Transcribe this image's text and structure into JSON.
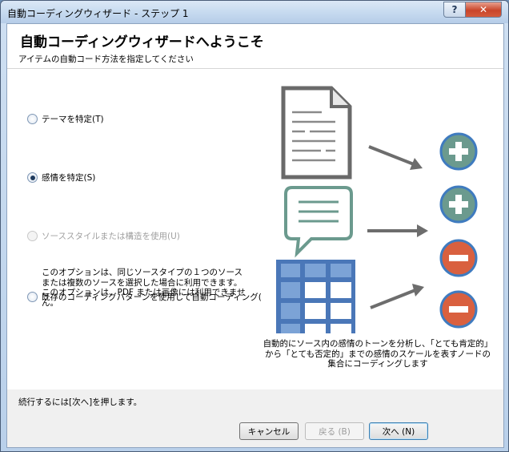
{
  "window": {
    "title": "自動コーディングウィザード - ステップ 1",
    "help_label": "?",
    "close_label": "✕"
  },
  "header": {
    "title": "自動コーディングウィザードへようこそ",
    "subtitle": "アイテムの自動コード方法を指定してください"
  },
  "options": {
    "theme": {
      "label": "テーマを特定(T)",
      "checked": false,
      "enabled": true
    },
    "sentiment": {
      "label": "感情を特定(S)",
      "checked": true,
      "enabled": true
    },
    "structure": {
      "label": "ソーススタイルまたは構造を使用(U)",
      "checked": false,
      "enabled": false,
      "description": "このオプションは、同じソースタイプの１つのソースまたは複数のソースを選択した場合に利用できます。このオプションは、PDF または画像には利用できません。"
    },
    "pattern": {
      "label": "既存のコーディングパターンを使用して自動コーディング(",
      "checked": false,
      "enabled": true
    }
  },
  "illustration": {
    "caption": "自動的にソース内の感情のトーンを分析し、「とても肯定的」から「とても否定的」までの感情のスケールを表すノードの集合にコーディングします",
    "icons": [
      "document-icon",
      "speech-bubble-icon",
      "dataset-table-icon",
      "plus-circle-icon",
      "plus-circle-icon",
      "minus-circle-icon",
      "minus-circle-icon"
    ],
    "colors": {
      "plus": "#6b9a8e",
      "minus": "#d9603f",
      "doc_stroke": "#6a6a6a",
      "bubble": "#6b9a8e",
      "table": "#4a77b8",
      "arrow": "#6d6d6d"
    }
  },
  "footer": {
    "hint": "続行するには[次へ]を押します。"
  },
  "buttons": {
    "cancel": "キャンセル",
    "back": "戻る (B)",
    "next": "次へ (N)"
  }
}
